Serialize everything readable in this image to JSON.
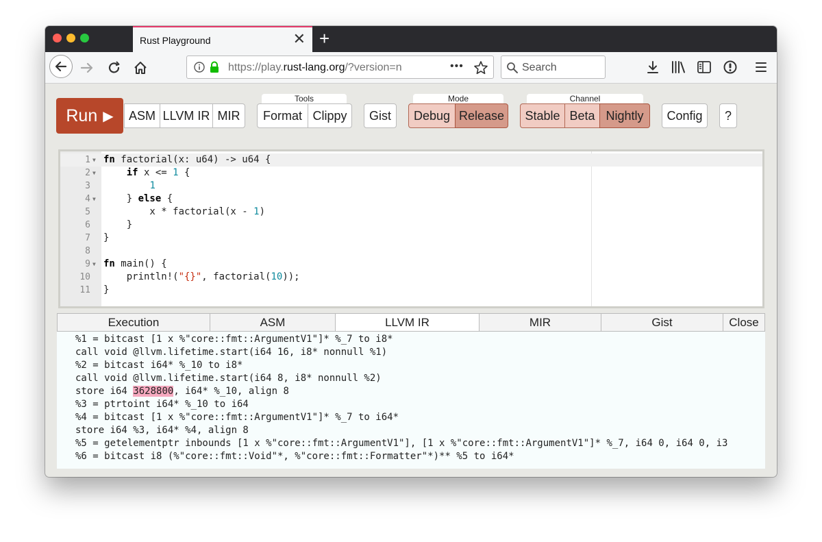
{
  "browser": {
    "tab_title": "Rust Playground",
    "tab_close": "✕",
    "new_tab": "+",
    "url_prefix": "https://play.",
    "url_domain": "rust-lang.org",
    "url_rest": "/?version=n",
    "url_more": "•••",
    "search_placeholder": "Search"
  },
  "toolbar": {
    "run_label": "Run",
    "run_icon": "▶",
    "asm": "ASM",
    "llvm_ir": "LLVM IR",
    "mir": "MIR",
    "tools_label": "Tools",
    "format": "Format",
    "clippy": "Clippy",
    "gist": "Gist",
    "mode_label": "Mode",
    "debug": "Debug",
    "release": "Release",
    "channel_label": "Channel",
    "stable": "Stable",
    "beta": "Beta",
    "nightly": "Nightly",
    "config": "Config",
    "help": "?"
  },
  "editor": {
    "lines": [
      {
        "n": "1",
        "fold": true,
        "html": "<span class=\"k\">fn</span> factorial(x: u64) -&gt; u64 {"
      },
      {
        "n": "2",
        "fold": true,
        "html": "    <span class=\"k\">if</span> x &lt;= <span class=\"n\">1</span> {"
      },
      {
        "n": "3",
        "fold": false,
        "html": "        <span class=\"n\">1</span>"
      },
      {
        "n": "4",
        "fold": true,
        "html": "    } <span class=\"k\">else</span> {"
      },
      {
        "n": "5",
        "fold": false,
        "html": "        x * factorial(x - <span class=\"n\">1</span>)"
      },
      {
        "n": "6",
        "fold": false,
        "html": "    }"
      },
      {
        "n": "7",
        "fold": false,
        "html": "}"
      },
      {
        "n": "8",
        "fold": false,
        "html": ""
      },
      {
        "n": "9",
        "fold": true,
        "html": "<span class=\"k\">fn</span> main() {"
      },
      {
        "n": "10",
        "fold": false,
        "html": "    println!(<span class=\"s\">\"{}\"</span>, factorial(<span class=\"n\">10</span>));"
      },
      {
        "n": "11",
        "fold": false,
        "html": "}"
      }
    ]
  },
  "output": {
    "tabs": [
      "Execution",
      "ASM",
      "LLVM IR",
      "MIR",
      "Gist",
      "Close"
    ],
    "active_tab": "LLVM IR",
    "lines": [
      "%1 = bitcast [1 x %\"core::fmt::ArgumentV1\"]* %_7 to i8*",
      "call void @llvm.lifetime.start(i64 16, i8* nonnull %1)",
      "%2 = bitcast i64* %_10 to i8*",
      "call void @llvm.lifetime.start(i64 8, i8* nonnull %2)",
      "store i64 [[3628800]], i64* %_10, align 8",
      "%3 = ptrtoint i64* %_10 to i64",
      "%4 = bitcast [1 x %\"core::fmt::ArgumentV1\"]* %_7 to i64*",
      "store i64 %3, i64* %4, align 8",
      "%5 = getelementptr inbounds [1 x %\"core::fmt::ArgumentV1\"], [1 x %\"core::fmt::ArgumentV1\"]* %_7, i64 0, i64 0, i3",
      "%6 = bitcast i8 (%\"core::fmt::Void\"*, %\"core::fmt::Formatter\"*)** %5 to i64*"
    ]
  }
}
